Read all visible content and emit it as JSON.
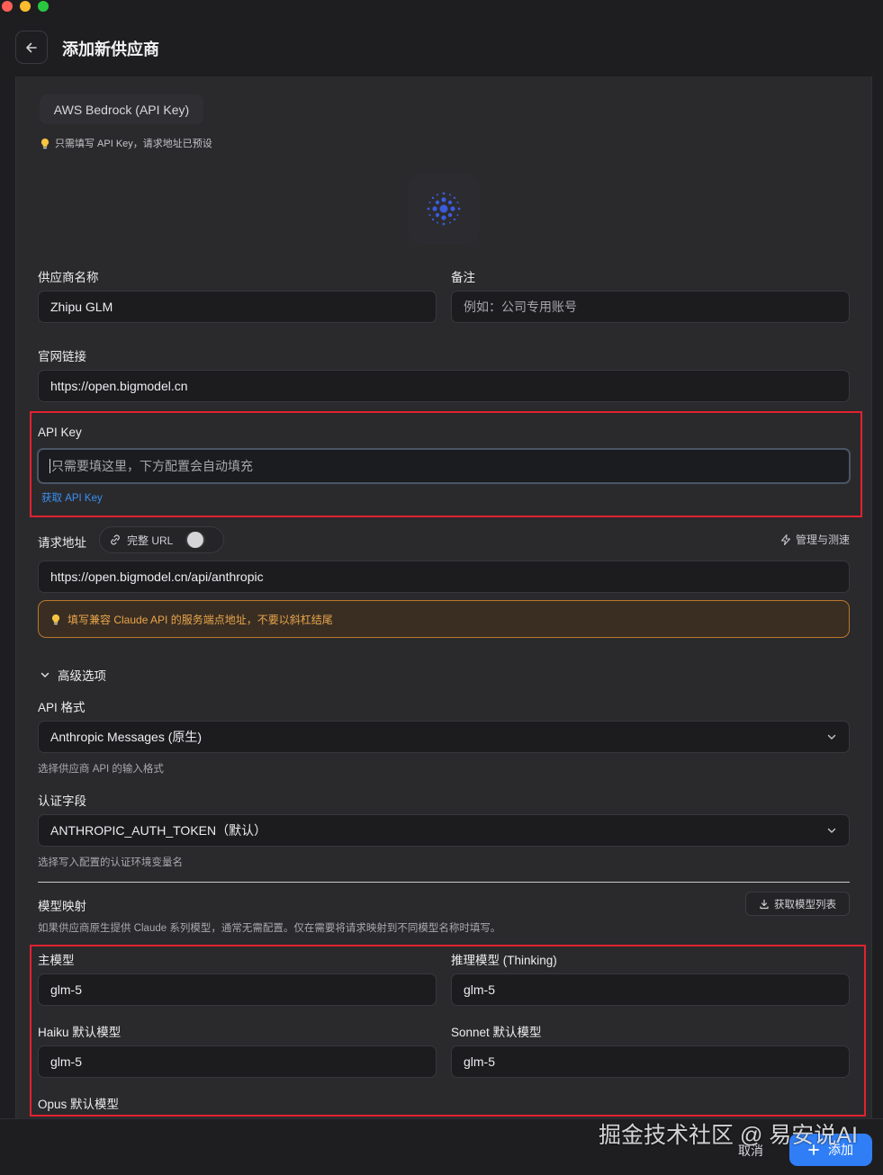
{
  "window": {
    "title": "添加新供应商"
  },
  "preset": {
    "name": "AWS Bedrock (API Key)",
    "hint": "只需填写 API Key，请求地址已预设"
  },
  "form": {
    "provider_name": {
      "label": "供应商名称",
      "value": "Zhipu GLM"
    },
    "note": {
      "label": "备注",
      "placeholder": "例如：公司专用账号"
    },
    "website": {
      "label": "官网链接",
      "value": "https://open.bigmodel.cn"
    },
    "api_key": {
      "label": "API Key",
      "placeholder": "只需要填这里，下方配置会自动填充",
      "get_link": "获取 API Key"
    },
    "endpoint": {
      "label": "请求地址",
      "full_url_toggle_label": "完整 URL",
      "full_url_enabled": false,
      "manage_label": "管理与测速",
      "value": "https://open.bigmodel.cn/api/anthropic",
      "warning": "填写兼容 Claude API 的服务端点地址，不要以斜杠结尾"
    },
    "advanced": {
      "toggle_label": "高级选项",
      "api_format": {
        "label": "API 格式",
        "value": "Anthropic Messages (原生)",
        "help": "选择供应商 API 的输入格式"
      },
      "auth_field": {
        "label": "认证字段",
        "value": "ANTHROPIC_AUTH_TOKEN（默认）",
        "help": "选择写入配置的认证环境变量名"
      }
    },
    "model_mapping": {
      "title": "模型映射",
      "description": "如果供应商原生提供 Claude 系列模型，通常无需配置。仅在需要将请求映射到不同模型名称时填写。",
      "fetch_label": "获取模型列表",
      "main_model": {
        "label": "主模型",
        "value": "glm-5"
      },
      "thinking_model": {
        "label": "推理模型 (Thinking)",
        "value": "glm-5"
      },
      "haiku_model": {
        "label": "Haiku 默认模型",
        "value": "glm-5"
      },
      "sonnet_model": {
        "label": "Sonnet 默认模型",
        "value": "glm-5"
      },
      "opus_model": {
        "label": "Opus 默认模型"
      }
    }
  },
  "footer": {
    "cancel_label": "取消",
    "add_label": "添加"
  },
  "watermark": "掘金技术社区 @ 易安说AI",
  "colors": {
    "accent": "#2f7ef6",
    "highlight_border": "#e0222f",
    "warning": "#e8a54b",
    "link": "#3b8ff0"
  }
}
